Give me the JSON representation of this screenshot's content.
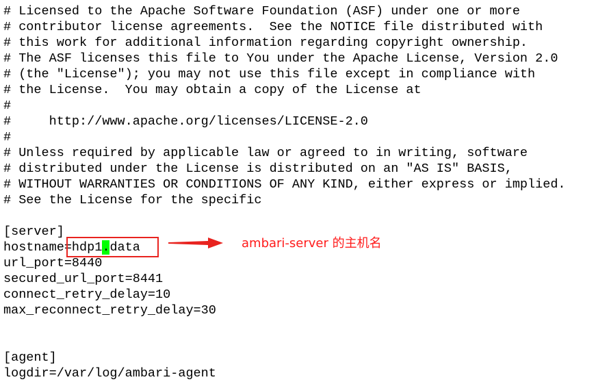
{
  "license_lines": [
    "# Licensed to the Apache Software Foundation (ASF) under one or more",
    "# contributor license agreements.  See the NOTICE file distributed with",
    "# this work for additional information regarding copyright ownership.",
    "# The ASF licenses this file to You under the Apache License, Version 2.0",
    "# (the \"License\"); you may not use this file except in compliance with",
    "# the License.  You may obtain a copy of the License at",
    "#",
    "#     http://www.apache.org/licenses/LICENSE-2.0",
    "#",
    "# Unless required by applicable law or agreed to in writing, software",
    "# distributed under the License is distributed on an \"AS IS\" BASIS,",
    "# WITHOUT WARRANTIES OR CONDITIONS OF ANY KIND, either express or implied.",
    "# See the License for the specific"
  ],
  "server": {
    "section": "[server]",
    "hostname_key": "hostname=",
    "hostname_prefix": "hdp1",
    "hostname_cursor": ".",
    "hostname_suffix": "data",
    "url_port": "url_port=8440",
    "secured_url_port": "secured_url_port=8441",
    "connect_retry_delay": "connect_retry_delay=10",
    "max_reconnect_retry_delay": "max_reconnect_retry_delay=30"
  },
  "agent": {
    "section": "[agent]",
    "logdir": "logdir=/var/log/ambari-agent"
  },
  "annotation": {
    "text": "ambari-server 的主机名",
    "color": "#ff1b1b"
  },
  "colors": {
    "background": "#ffffff",
    "text": "#000000",
    "cursor": "#00ff00",
    "highlight_border": "#e8231f"
  }
}
